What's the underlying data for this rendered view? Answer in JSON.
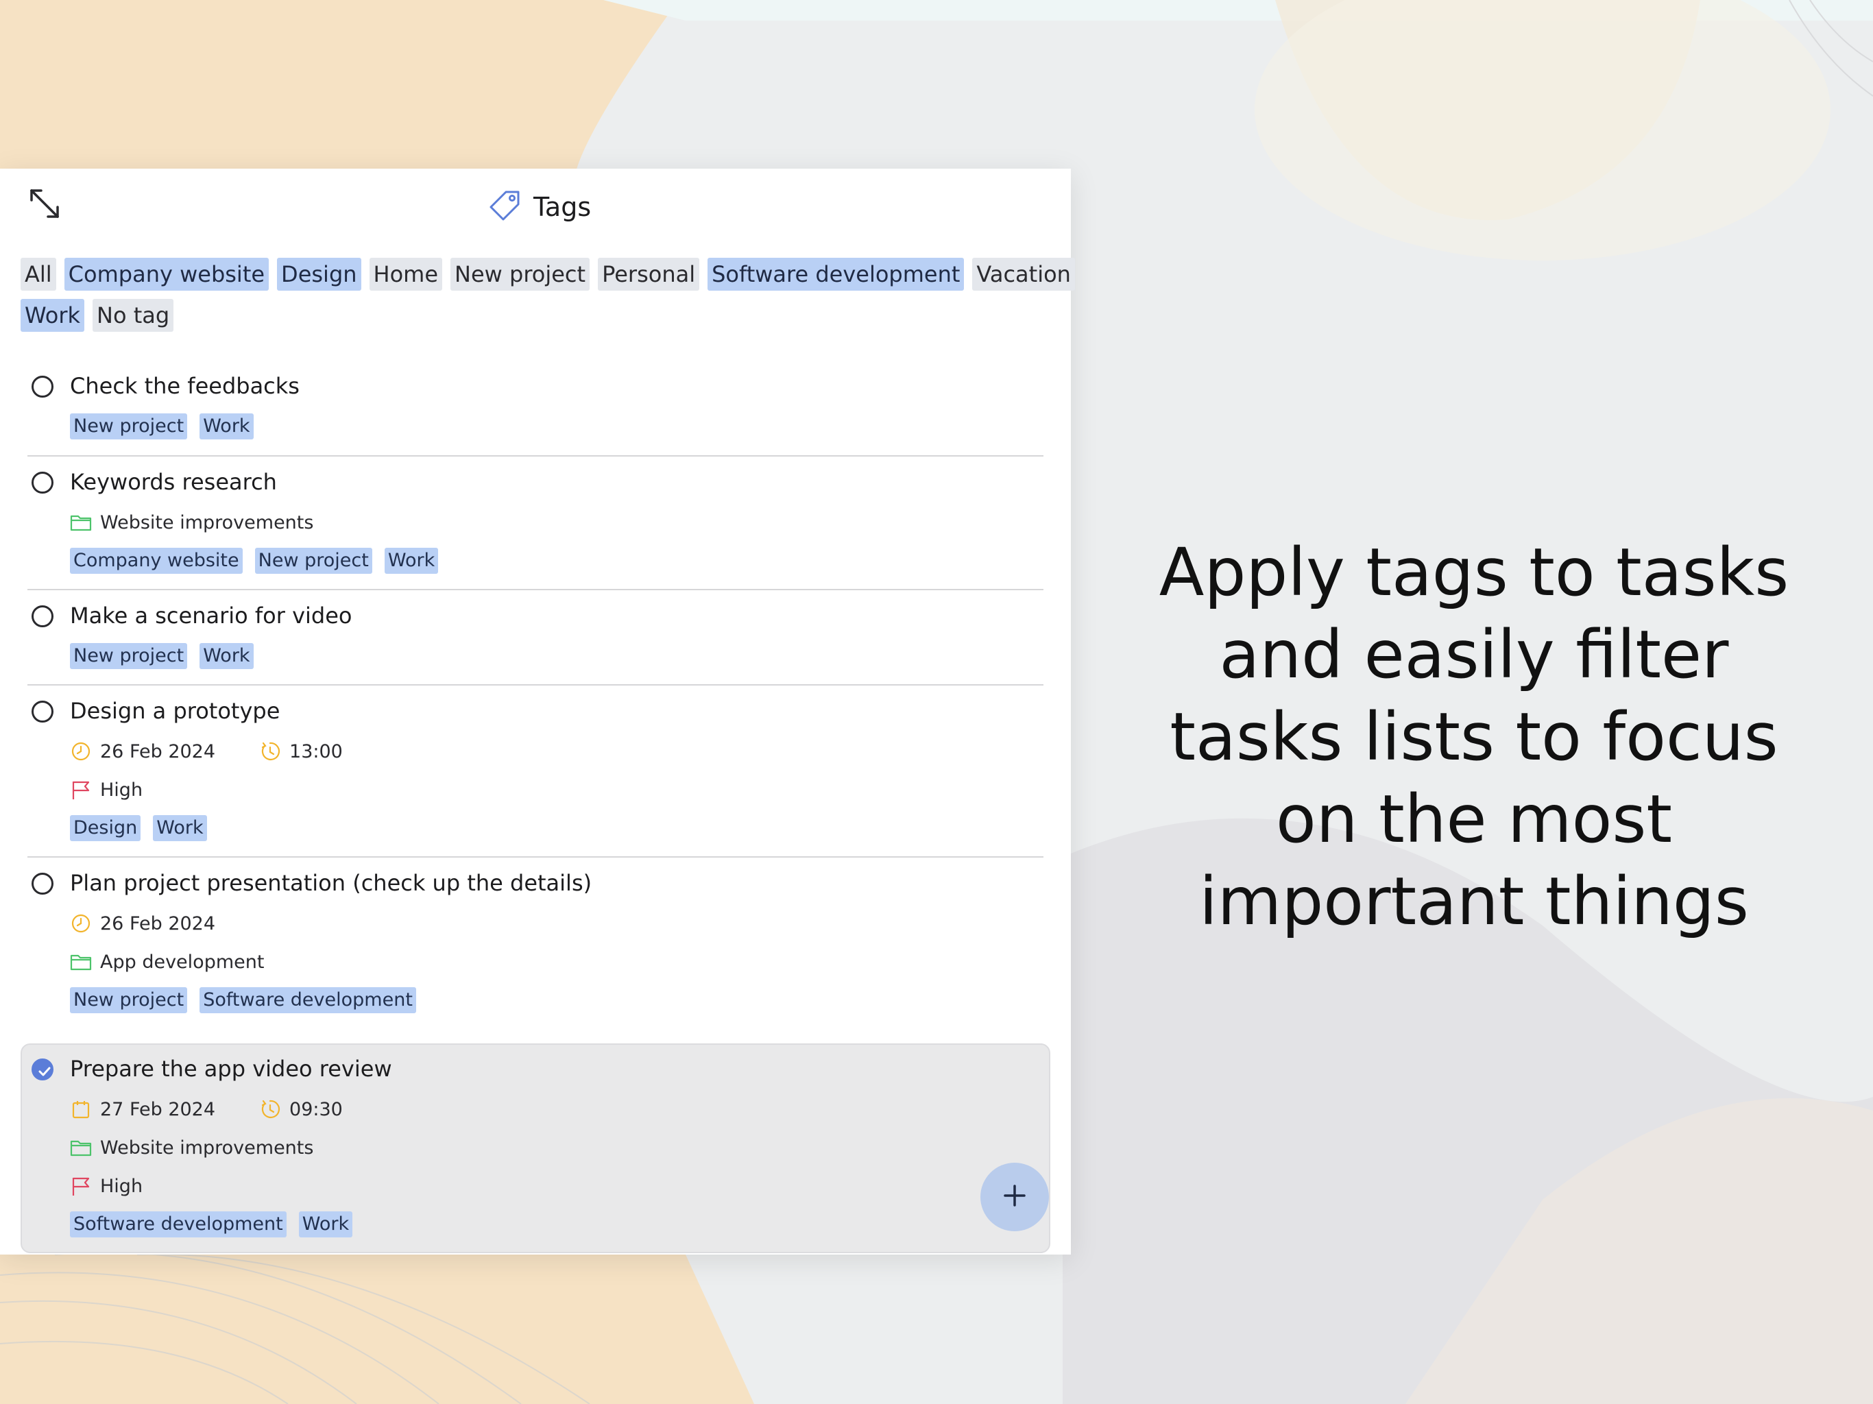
{
  "header": {
    "title": "Tags",
    "title_icon": "tag-icon",
    "expand_icon": "expand-icon"
  },
  "filters": {
    "row1": [
      {
        "label": "All",
        "selected": false
      },
      {
        "label": "Company website",
        "selected": true
      },
      {
        "label": "Design",
        "selected": true
      },
      {
        "label": "Home",
        "selected": false
      },
      {
        "label": "New project",
        "selected": false
      },
      {
        "label": "Personal",
        "selected": false
      },
      {
        "label": "Software development",
        "selected": true
      },
      {
        "label": "Vacation",
        "selected": false
      }
    ],
    "row2": [
      {
        "label": "Work",
        "selected": true
      },
      {
        "label": "No tag",
        "selected": false
      }
    ]
  },
  "tasks": [
    {
      "title": "Check the feedbacks",
      "tags": [
        "New project",
        "Work"
      ]
    },
    {
      "title": "Keywords research",
      "list": "Website improvements",
      "tags": [
        "Company website",
        "New project",
        "Work"
      ]
    },
    {
      "title": "Make a scenario for video",
      "tags": [
        "New project",
        "Work"
      ]
    },
    {
      "title": "Design a prototype",
      "date": "26 Feb 2024",
      "time": "13:00",
      "priority": "High",
      "tags": [
        "Design",
        "Work"
      ]
    },
    {
      "title": "Plan project presentation (check up the details)",
      "date": "26 Feb 2024",
      "list": "App development",
      "tags": [
        "New project",
        "Software development"
      ]
    },
    {
      "title": "Prepare the app video review",
      "completed": true,
      "date": "27 Feb 2024",
      "time": "09:30",
      "list": "Website improvements",
      "priority": "High",
      "tags": [
        "Software development",
        "Work"
      ]
    }
  ],
  "fab": {
    "icon": "plus-icon"
  },
  "promo": {
    "lines": [
      "Apply tags to tasks",
      "and easily filter",
      "tasks lists to focus",
      "on the most",
      "important things"
    ]
  },
  "colors": {
    "accent": "#5b7dd8",
    "tag_bg": "#b9d0f5",
    "chip_bg": "#e4e7ec",
    "list_icon": "#4cc36a",
    "date_icon": "#f2b42c",
    "priority_icon": "#e04660"
  }
}
